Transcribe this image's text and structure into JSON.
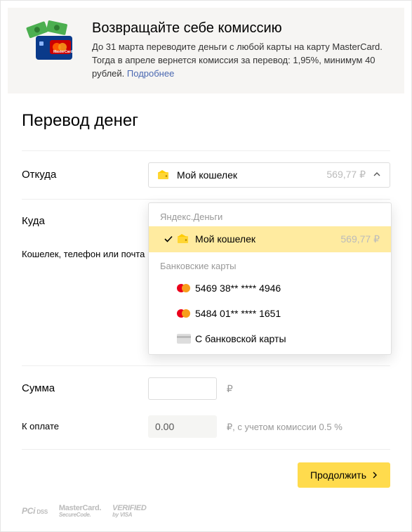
{
  "promo": {
    "title": "Возвращайте себе комиссию",
    "text": "До 31 марта переводите деньги с любой карты на карту MasterCard. Тогда в апреле вернется комиссия за перевод: 1,95%, минимум 40 рублей. ",
    "link": "Подробнее"
  },
  "page_title": "Перевод денег",
  "from": {
    "label": "Откуда",
    "selected_name": "Мой кошелек",
    "selected_balance": "569,77 ₽"
  },
  "dropdown": {
    "group1_label": "Яндекс.Деньги",
    "wallet_name": "Мой кошелек",
    "wallet_balance": "569,77 ₽",
    "group2_label": "Банковские карты",
    "card1": "5469 38** **** 4946",
    "card2": "5484 01** **** 1651",
    "other_card": "С банковской карты"
  },
  "to": {
    "label": "Куда",
    "sublabel": "Кошелек, телефон или почта"
  },
  "amount": {
    "label": "Сумма",
    "currency": "₽"
  },
  "total": {
    "label": "К оплате",
    "value": "0.00",
    "fee_text": "₽, с учетом комиссии 0.5 %"
  },
  "continue_label": "Продолжить",
  "badges": {
    "pci": "PCI DSS",
    "msc_top": "MasterCard.",
    "msc_bot": "SecureCode.",
    "visa_top": "VERIFIED",
    "visa_bot": "by VISA"
  }
}
